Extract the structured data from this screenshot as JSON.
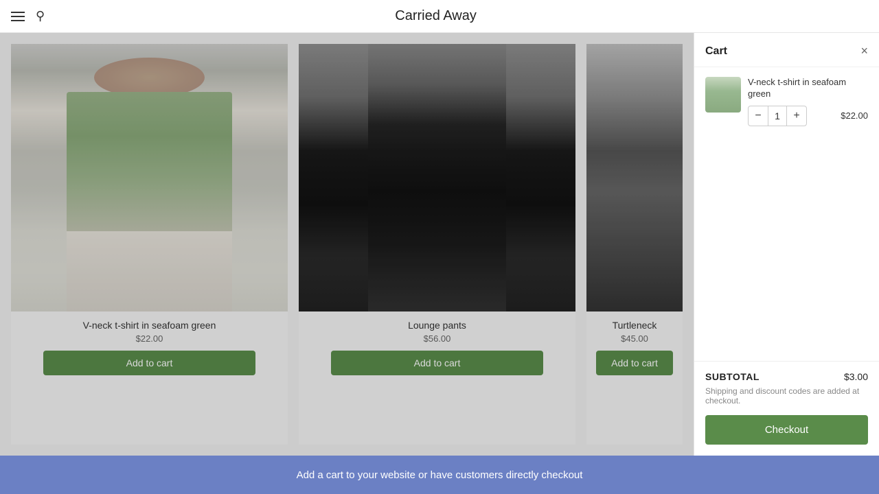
{
  "header": {
    "title": "Carried Away",
    "hamburger_label": "menu",
    "search_label": "search"
  },
  "products": [
    {
      "name": "V-neck t-shirt in seafoam green",
      "price": "$22.00",
      "add_to_cart_label": "Add to cart",
      "img_class": "product-img-1"
    },
    {
      "name": "Lounge pants",
      "price": "$56.00",
      "add_to_cart_label": "Add to cart",
      "img_class": "product-img-2"
    },
    {
      "name": "Turtleneck",
      "price": "$45.00",
      "add_to_cart_label": "Add to cart",
      "img_class": "product-img-3"
    }
  ],
  "cart": {
    "title": "Cart",
    "close_label": "×",
    "item": {
      "name": "V-neck t-shirt in seafoam green",
      "price": "$22.00",
      "quantity": 1,
      "decrease_label": "−",
      "increase_label": "+"
    },
    "subtotal_label": "SUBTOTAL",
    "subtotal_value": "$3.00",
    "shipping_note": "Shipping and discount codes are added at checkout.",
    "checkout_label": "Checkout"
  },
  "banner": {
    "text": "Add a cart to your website or have customers directly checkout"
  }
}
